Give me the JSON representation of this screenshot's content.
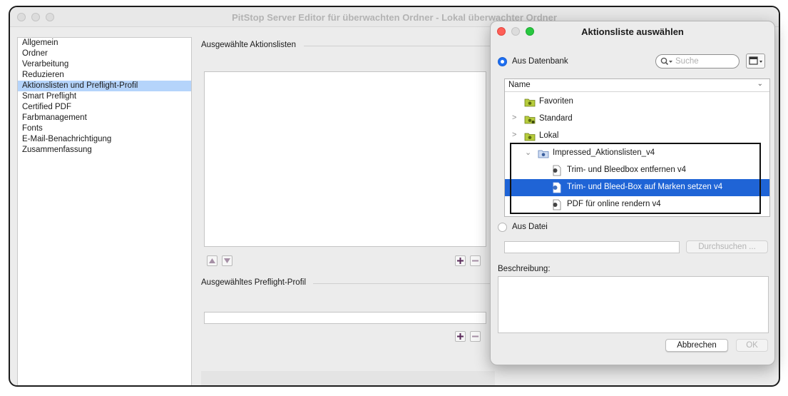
{
  "main_window": {
    "title": "PitStop Server Editor für überwachten Ordner - Lokal überwachter Ordner",
    "nav_items": [
      {
        "label": "Allgemein"
      },
      {
        "label": "Ordner"
      },
      {
        "label": "Verarbeitung"
      },
      {
        "label": "Reduzieren"
      },
      {
        "label": "Aktionslisten und Preflight-Profil",
        "selected": true
      },
      {
        "label": "Smart Preflight"
      },
      {
        "label": "Certified PDF"
      },
      {
        "label": "Farbmanagement"
      },
      {
        "label": "Fonts"
      },
      {
        "label": "E-Mail-Benachrichtigung"
      },
      {
        "label": "Zusammenfassung"
      }
    ],
    "selected_action_lists_title": "Ausgewählte Aktionslisten",
    "selected_preflight_profile_title": "Ausgewähltes Preflight-Profil"
  },
  "dialog": {
    "title": "Aktionsliste auswählen",
    "source_database_label": "Aus Datenbank",
    "source_file_label": "Aus Datei",
    "search_placeholder": "Suche",
    "tree_header": "Name",
    "tree_items": {
      "favorites": "Favoriten",
      "standard": "Standard",
      "local": "Lokal",
      "impressed_folder": "Impressed_Aktionslisten_v4",
      "item_remove_boxes": "Trim- und Bleedbox entfernen v4",
      "item_set_boxes": "Trim- und Bleed-Box auf Marken setzen v4",
      "item_render_online": "PDF für online rendern v4"
    },
    "browse_label": "Durchsuchen ...",
    "description_label": "Beschreibung:",
    "cancel_label": "Abbrechen",
    "ok_label": "OK"
  },
  "colors": {
    "selection_blue": "#1f64d6",
    "sidebar_selection": "#b5d4fb",
    "radio_blue": "#1e6ff2",
    "folder_green": "#b6cc3c",
    "traffic_red": "#fe5f57",
    "traffic_yellow": "#febc2e",
    "traffic_green": "#28c840"
  },
  "icons": [
    "search-icon",
    "calendar-icon",
    "folder-icon",
    "action-list-icon",
    "arrow-up-icon",
    "arrow-down-icon",
    "plus-icon",
    "minus-icon"
  ]
}
